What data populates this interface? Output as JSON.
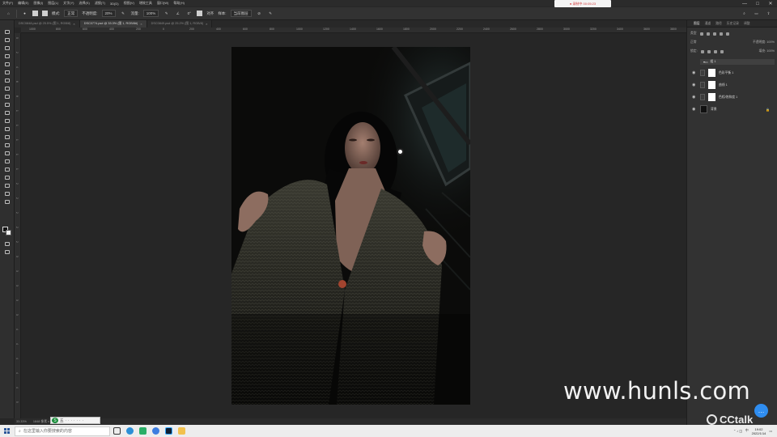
{
  "menu": [
    "文件(F)",
    "编辑(E)",
    "图像(I)",
    "图层(L)",
    "文字(Y)",
    "选择(S)",
    "滤镜(T)",
    "3D(D)",
    "视图(V)",
    "增效工具",
    "窗口(W)",
    "帮助(H)"
  ],
  "recording": {
    "label": "● 录制中 00:05:23",
    "color": "#e0322d"
  },
  "window_controls": [
    "—",
    "□",
    "✕"
  ],
  "options": {
    "mode_label": "模式:",
    "mode_value": "正常",
    "opacity_label": "不透明度:",
    "opacity_value": "20%",
    "flow_label": "流量:",
    "flow_value": "100%",
    "angle_value": "0°",
    "sample_label": "对齐",
    "sample_check_label": "样本:",
    "sample_value": "当前图层"
  },
  "tabs": [
    {
      "label": "DSC0848.psd @ 25.5% (图 1, RGB/8)",
      "active": false
    },
    {
      "label": "DSC0774.psd @ 33.3% (图 1, RGB/8#)",
      "active": true
    },
    {
      "label": "DSC0849.psd @ 25.2% (图 1, RGB/8)",
      "active": false
    }
  ],
  "ruler_h": [
    "1000",
    "800",
    "600",
    "400",
    "200",
    "0",
    "200",
    "400",
    "600",
    "800",
    "1000",
    "1200",
    "1400",
    "1600",
    "1800",
    "2000",
    "2200",
    "2400",
    "2600",
    "2800",
    "3000",
    "3200",
    "3400",
    "3600",
    "3800",
    "4000"
  ],
  "ruler_v": [
    "0",
    "2",
    "4",
    "6",
    "8",
    "1",
    "1",
    "1",
    "1",
    "1",
    "2",
    "2",
    "2",
    "2",
    "2",
    "3",
    "3",
    "3",
    "3",
    "3",
    "4",
    "4",
    "4",
    "4",
    "4",
    "5"
  ],
  "status": {
    "zoom": "33.33%",
    "doc": "1848 像素 x 2772 像素 (300 ppi)"
  },
  "ime": {
    "brand": "S",
    "labels": [
      "五",
      "·",
      "·",
      "·",
      "·",
      "·",
      "·",
      "·"
    ]
  },
  "panel": {
    "tabs": [
      "图层",
      "通道",
      "路径",
      "历史记录",
      "调整"
    ],
    "active_tab": 0,
    "filter_label": "类型",
    "blend_value": "正常",
    "opacity_label": "不透明度: 100%",
    "lock_label": "锁定:",
    "fill_label": "填充: 100%",
    "group_name": "组 1",
    "layers": [
      {
        "name": "色彩平衡 1",
        "type": "adjust"
      },
      {
        "name": "曲线 1",
        "type": "adjust"
      },
      {
        "name": "色相/饱和度 1",
        "type": "adjust"
      },
      {
        "name": "背景",
        "type": "background"
      }
    ]
  },
  "watermark": "www.hunls.com",
  "cctalk": "CCtalk",
  "taskbar": {
    "search_placeholder": "在这里输入你要搜索的内容",
    "tray_lang": "中",
    "time": "19:02",
    "date": "2022/1/14"
  },
  "colors": {
    "accent": "#2f8df0",
    "rec": "#e0322d",
    "ime_green": "#1a8d3b"
  }
}
